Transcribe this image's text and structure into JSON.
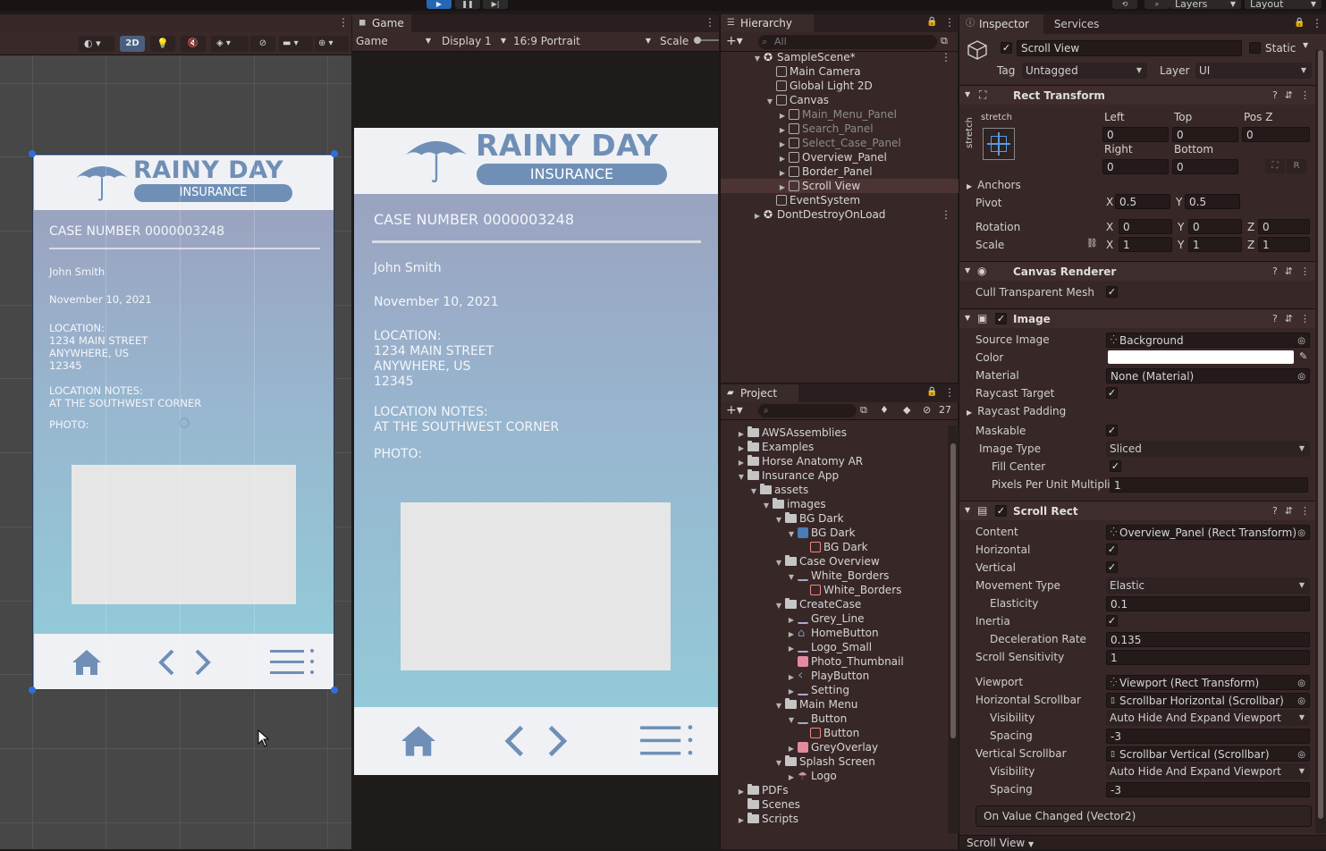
{
  "toolbar": {
    "layers": "Layers",
    "layout": "Layout",
    "play": "▶",
    "pause": "❚❚",
    "step": "▶|"
  },
  "scene": {
    "btn_2d": "2D"
  },
  "app": {
    "logo_title": "RAINY DAY",
    "logo_sub": "INSURANCE",
    "case_number": "CASE NUMBER 0000003248",
    "name": "John Smith",
    "date": "November 10, 2021",
    "location_label": "LOCATION:",
    "location_lines": [
      "1234 MAIN STREET",
      "ANYWHERE, US",
      "12345"
    ],
    "location_notes_label": "LOCATION NOTES:",
    "location_notes": "AT THE SOUTHWEST CORNER",
    "photo_label": "PHOTO:"
  },
  "game": {
    "tab": "Game",
    "mode": "Game",
    "display": "Display 1",
    "aspect": "16:9 Portrait",
    "scale_label": "Scale"
  },
  "hierarchy": {
    "tab": "Hierarchy",
    "search_placeholder": "All",
    "items": [
      {
        "label": "SampleScene*",
        "depth": 0,
        "arrow": "▼",
        "kind": "scene"
      },
      {
        "label": "Main Camera",
        "depth": 1,
        "arrow": "",
        "kind": "obj"
      },
      {
        "label": "Global Light 2D",
        "depth": 1,
        "arrow": "",
        "kind": "obj"
      },
      {
        "label": "Canvas",
        "depth": 1,
        "arrow": "▼",
        "kind": "obj"
      },
      {
        "label": "Main_Menu_Panel",
        "depth": 2,
        "arrow": "▶",
        "kind": "obj",
        "dim": true
      },
      {
        "label": "Search_Panel",
        "depth": 2,
        "arrow": "▶",
        "kind": "obj",
        "dim": true
      },
      {
        "label": "Select_Case_Panel",
        "depth": 2,
        "arrow": "▶",
        "kind": "obj",
        "dim": true
      },
      {
        "label": "Overview_Panel",
        "depth": 2,
        "arrow": "▶",
        "kind": "obj"
      },
      {
        "label": "Border_Panel",
        "depth": 2,
        "arrow": "▶",
        "kind": "obj"
      },
      {
        "label": "Scroll View",
        "depth": 2,
        "arrow": "▶",
        "kind": "obj",
        "sel": true
      },
      {
        "label": "EventSystem",
        "depth": 1,
        "arrow": "",
        "kind": "obj"
      },
      {
        "label": "DontDestroyOnLoad",
        "depth": 0,
        "arrow": "▶",
        "kind": "scene"
      }
    ]
  },
  "project": {
    "tab": "Project",
    "hidden_count": "27",
    "items": [
      {
        "label": "AWSAssemblies",
        "depth": 1,
        "arrow": "▶",
        "kind": "folder"
      },
      {
        "label": "Examples",
        "depth": 1,
        "arrow": "▶",
        "kind": "folder"
      },
      {
        "label": "Horse Anatomy AR",
        "depth": 1,
        "arrow": "▶",
        "kind": "folder"
      },
      {
        "label": "Insurance App",
        "depth": 1,
        "arrow": "▼",
        "kind": "folder"
      },
      {
        "label": "assets",
        "depth": 2,
        "arrow": "▼",
        "kind": "folder"
      },
      {
        "label": "images",
        "depth": 3,
        "arrow": "▼",
        "kind": "folder"
      },
      {
        "label": "BG Dark",
        "depth": 4,
        "arrow": "▼",
        "kind": "folder"
      },
      {
        "label": "BG Dark",
        "depth": 5,
        "arrow": "▼",
        "kind": "sprite-blue"
      },
      {
        "label": "BG Dark",
        "depth": 6,
        "arrow": "",
        "kind": "sprite-sub"
      },
      {
        "label": "Case Overview",
        "depth": 4,
        "arrow": "▼",
        "kind": "folder"
      },
      {
        "label": "White_Borders",
        "depth": 5,
        "arrow": "▼",
        "kind": "sprite-line"
      },
      {
        "label": "White_Borders",
        "depth": 6,
        "arrow": "",
        "kind": "sprite-sub"
      },
      {
        "label": "CreateCase",
        "depth": 4,
        "arrow": "▼",
        "kind": "folder"
      },
      {
        "label": "Grey_Line",
        "depth": 5,
        "arrow": "▶",
        "kind": "sprite-line"
      },
      {
        "label": "HomeButton",
        "depth": 5,
        "arrow": "▶",
        "kind": "sprite-home"
      },
      {
        "label": "Logo_Small",
        "depth": 5,
        "arrow": "▶",
        "kind": "sprite-line"
      },
      {
        "label": "Photo_Thumbnail",
        "depth": 5,
        "arrow": "",
        "kind": "sprite-pink"
      },
      {
        "label": "PlayButton",
        "depth": 5,
        "arrow": "▶",
        "kind": "sprite-play"
      },
      {
        "label": "Setting",
        "depth": 5,
        "arrow": "▶",
        "kind": "sprite-line"
      },
      {
        "label": "Main Menu",
        "depth": 4,
        "arrow": "▼",
        "kind": "folder"
      },
      {
        "label": "Button",
        "depth": 5,
        "arrow": "▼",
        "kind": "sprite-line"
      },
      {
        "label": "Button",
        "depth": 6,
        "arrow": "",
        "kind": "sprite-sub"
      },
      {
        "label": "GreyOverlay",
        "depth": 5,
        "arrow": "▶",
        "kind": "sprite-pink"
      },
      {
        "label": "Splash Screen",
        "depth": 4,
        "arrow": "▼",
        "kind": "folder"
      },
      {
        "label": "Logo",
        "depth": 5,
        "arrow": "▶",
        "kind": "sprite-logo"
      },
      {
        "label": "PDFs",
        "depth": 1,
        "arrow": "▶",
        "kind": "folder"
      },
      {
        "label": "Scenes",
        "depth": 1,
        "arrow": "",
        "kind": "folder"
      },
      {
        "label": "Scripts",
        "depth": 1,
        "arrow": "▶",
        "kind": "folder"
      }
    ]
  },
  "inspector": {
    "tab": "Inspector",
    "tab2": "Services",
    "object_name": "Scroll View",
    "static_label": "Static",
    "tag_label": "Tag",
    "tag_value": "Untagged",
    "layer_label": "Layer",
    "layer_value": "UI",
    "rect_transform": {
      "title": "Rect Transform",
      "stretch": "stretch",
      "left_label": "Left",
      "left": "0",
      "top_label": "Top",
      "top": "0",
      "posz_label": "Pos Z",
      "posz": "0",
      "right_label": "Right",
      "right": "0",
      "bottom_label": "Bottom",
      "bottom": "0",
      "r_btn": "R",
      "anchors": "Anchors",
      "pivot_label": "Pivot",
      "pivot_x": "0.5",
      "pivot_y": "0.5",
      "rotation_label": "Rotation",
      "rot_x": "0",
      "rot_y": "0",
      "rot_z": "0",
      "scale_label": "Scale",
      "scale_x": "1",
      "scale_y": "1",
      "scale_z": "1",
      "x": "X",
      "y": "Y",
      "z": "Z"
    },
    "canvas_renderer": {
      "title": "Canvas Renderer",
      "cull_label": "Cull Transparent Mesh"
    },
    "image": {
      "title": "Image",
      "source_label": "Source Image",
      "source_value": "Background",
      "color_label": "Color",
      "material_label": "Material",
      "material_value": "None (Material)",
      "raycast_target_label": "Raycast Target",
      "raycast_padding_label": "Raycast Padding",
      "maskable_label": "Maskable",
      "image_type_label": "Image Type",
      "image_type_value": "Sliced",
      "fill_center_label": "Fill Center",
      "ppu_label": "Pixels Per Unit Multiplie",
      "ppu_value": "1"
    },
    "scroll_rect": {
      "title": "Scroll Rect",
      "content_label": "Content",
      "content_value": "Overview_Panel (Rect Transform)",
      "horizontal_label": "Horizontal",
      "vertical_label": "Vertical",
      "movement_label": "Movement Type",
      "movement_value": "Elastic",
      "elasticity_label": "Elasticity",
      "elasticity_value": "0.1",
      "inertia_label": "Inertia",
      "decel_label": "Deceleration Rate",
      "decel_value": "0.135",
      "sensitivity_label": "Scroll Sensitivity",
      "sensitivity_value": "1",
      "viewport_label": "Viewport",
      "viewport_value": "Viewport (Rect Transform)",
      "hscroll_label": "Horizontal Scrollbar",
      "hscroll_value": "Scrollbar Horizontal (Scrollbar)",
      "hvis_label": "Visibility",
      "hvis_value": "Auto Hide And Expand Viewport",
      "hspacing_label": "Spacing",
      "hspacing_value": "-3",
      "vscroll_label": "Vertical Scrollbar",
      "vscroll_value": "Scrollbar Vertical (Scrollbar)",
      "vvis_label": "Visibility",
      "vvis_value": "Auto Hide And Expand Viewport",
      "vspacing_label": "Spacing",
      "vspacing_value": "-3",
      "on_value_changed": "On Value Changed (Vector2)"
    },
    "footer": "Scroll View"
  },
  "colors": {
    "accent_blue": "#2566b5",
    "logo_blue": "#6f8fb7",
    "panel_bg": "#382727"
  }
}
